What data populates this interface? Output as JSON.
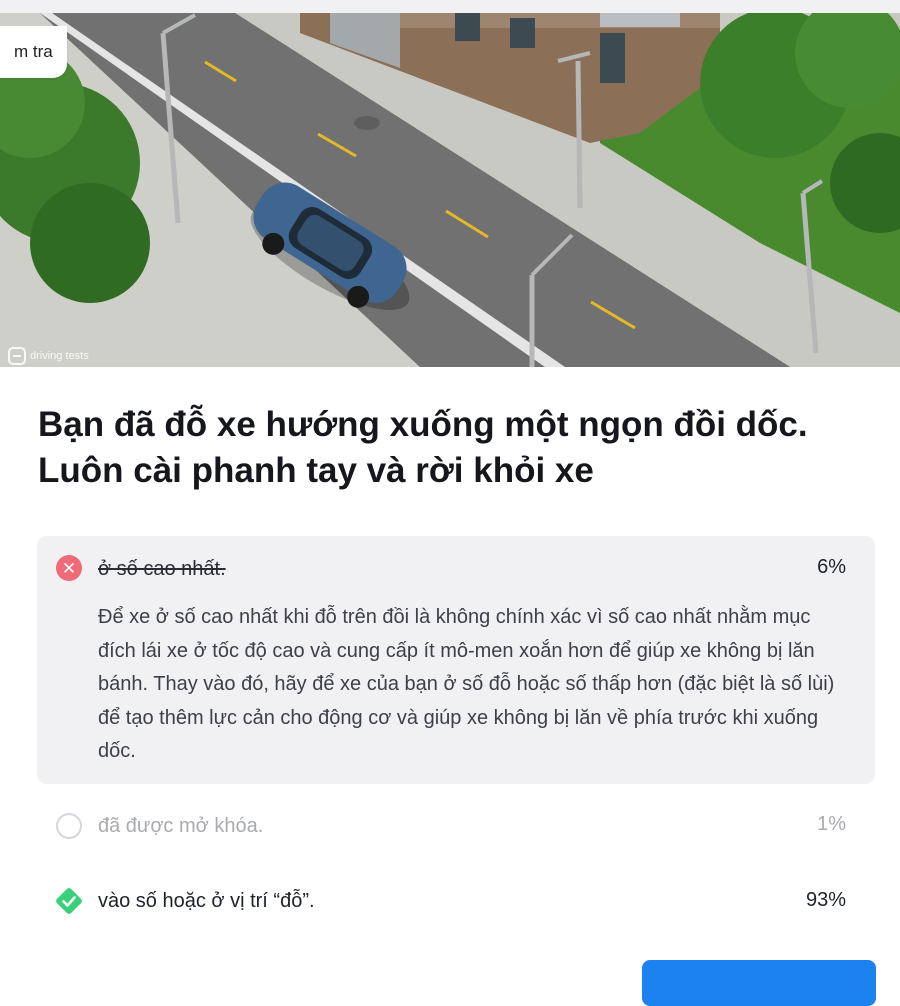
{
  "tab_chip": {
    "label": "m tra"
  },
  "image": {
    "watermark": "driving tests"
  },
  "question": {
    "line1": "Bạn đã đỗ xe hướng xuống một ngọn đồi dốc.",
    "line2": "Luôn cài phanh tay và rời khỏi xe"
  },
  "options": [
    {
      "label": "ở số cao nhất.",
      "percent": "6%",
      "state": "wrong-selected",
      "explanation": "Để xe ở số cao nhất khi đỗ trên đồi là không chính xác vì số cao nhất nhằm mục đích lái xe ở tốc độ cao và cung cấp ít mô-men xoắn hơn để giúp xe không bị lăn bánh. Thay vào đó, hãy để xe của bạn ở số đỗ hoặc số thấp hơn (đặc biệt là số lùi) để tạo thêm lực cản cho động cơ và giúp xe không bị lăn về phía trước khi xuống dốc."
    },
    {
      "label": "đã được mở khóa.",
      "percent": "1%",
      "state": "unselected"
    },
    {
      "label": "vào số hoặc ở vị trí “đỗ”.",
      "percent": "93%",
      "state": "correct"
    }
  ],
  "colors": {
    "wrong": "#f06b78",
    "correct": "#38d179",
    "accent": "#1c82f0",
    "box": "#f1f1f4"
  }
}
